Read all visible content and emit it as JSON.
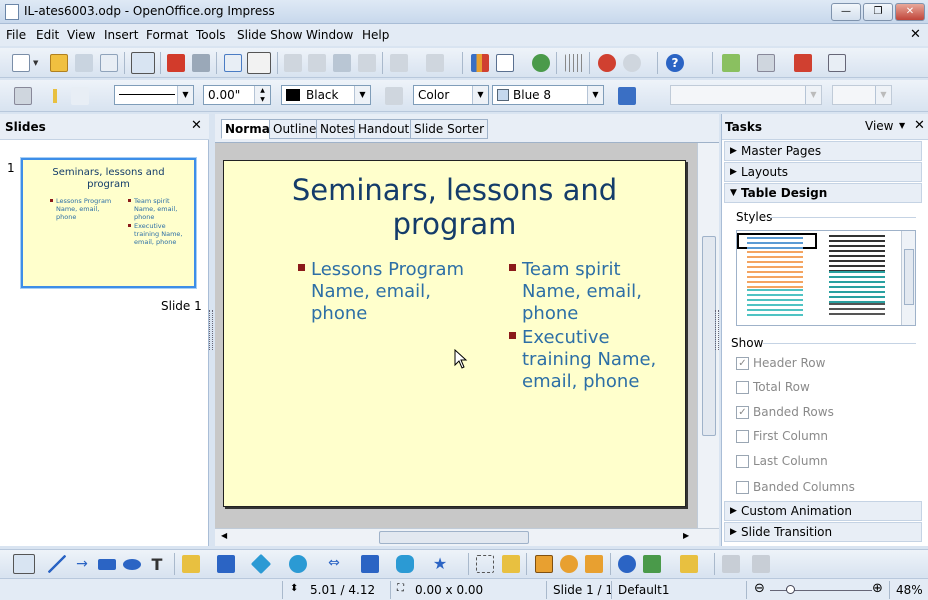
{
  "window": {
    "title": "IL-ates6003.odp - OpenOffice.org Impress"
  },
  "menu": [
    "File",
    "Edit",
    "View",
    "Insert",
    "Format",
    "Tools",
    "Slide Show",
    "Window",
    "Help"
  ],
  "line_toolbar": {
    "line_width": "0.00\"",
    "line_color": "Black",
    "area_type": "Color",
    "area_color": "Blue 8"
  },
  "slides_panel": {
    "title": "Slides",
    "slide_number": "1",
    "slide_label": "Slide 1"
  },
  "view_tabs": [
    "Normal",
    "Outline",
    "Notes",
    "Handout",
    "Slide Sorter"
  ],
  "slide": {
    "title": "Seminars, lessons and program",
    "left_bullets": [
      {
        "text": "Lessons Program Name, email, phone"
      }
    ],
    "right_bullets": [
      {
        "text": "Team spirit Name, email, phone"
      },
      {
        "text": "Executive training Name, email, phone"
      }
    ]
  },
  "tasks": {
    "title": "Tasks",
    "view_label": "View",
    "sections": [
      "Master Pages",
      "Layouts",
      "Table Design"
    ],
    "styles_label": "Styles",
    "show_label": "Show",
    "options": [
      {
        "label": "Header Row",
        "checked": true
      },
      {
        "label": "Total Row",
        "checked": false
      },
      {
        "label": "Banded Rows",
        "checked": true
      },
      {
        "label": "First Column",
        "checked": false
      },
      {
        "label": "Last Column",
        "checked": false
      },
      {
        "label": "Banded Columns",
        "checked": false
      }
    ],
    "bottom_sections": [
      "Custom Animation",
      "Slide Transition"
    ]
  },
  "status": {
    "position": "5.01 / 4.12",
    "size": "0.00 x 0.00",
    "slide": "Slide 1 / 1",
    "master": "Default1",
    "zoom": "48%"
  }
}
